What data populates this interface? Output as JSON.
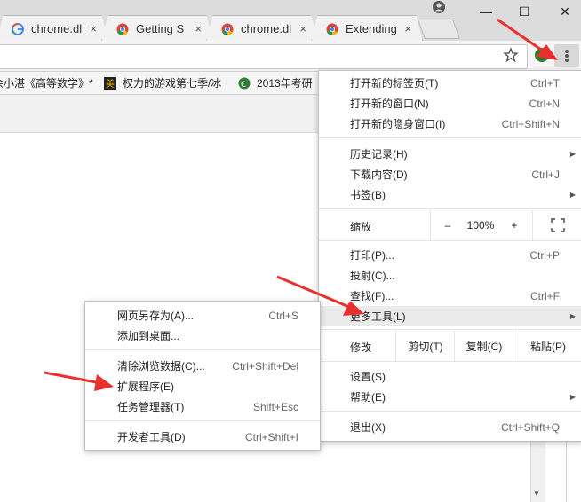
{
  "tabs": [
    {
      "title": "chrome.dl",
      "close": "×"
    },
    {
      "title": "Getting S",
      "close": "×"
    },
    {
      "title": "chrome.dl",
      "close": "×"
    },
    {
      "title": "Extending",
      "close": "×"
    }
  ],
  "window": {
    "minimize": "—",
    "maximize": "☐",
    "close": "✕"
  },
  "bookmarks": [
    {
      "label": "余小湛《高等数学》*"
    },
    {
      "label": "权力的游戏第七季/冰"
    },
    {
      "label": "2013年考研"
    }
  ],
  "menu": {
    "items": [
      {
        "label": "打开新的标签页(T)",
        "shortcut": "Ctrl+T"
      },
      {
        "label": "打开新的窗口(N)",
        "shortcut": "Ctrl+N"
      },
      {
        "label": "打开新的隐身窗口(I)",
        "shortcut": "Ctrl+Shift+N"
      },
      {
        "label": "历史记录(H)",
        "shortcut": ""
      },
      {
        "label": "下载内容(D)",
        "shortcut": "Ctrl+J"
      },
      {
        "label": "书签(B)",
        "shortcut": ""
      },
      {
        "label": "打印(P)...",
        "shortcut": "Ctrl+P"
      },
      {
        "label": "投射(C)...",
        "shortcut": ""
      },
      {
        "label": "查找(F)...",
        "shortcut": "Ctrl+F"
      },
      {
        "label": "更多工具(L)",
        "shortcut": ""
      },
      {
        "label": "设置(S)",
        "shortcut": ""
      },
      {
        "label": "帮助(E)",
        "shortcut": ""
      },
      {
        "label": "退出(X)",
        "shortcut": "Ctrl+Shift+Q"
      }
    ],
    "zoom": {
      "label": "缩放",
      "minus": "–",
      "value": "100%",
      "plus": "+"
    },
    "edit": {
      "label": "修改",
      "cut": "剪切(T)",
      "copy": "复制(C)",
      "paste": "粘贴(P)"
    },
    "submenu_arrow": "▶"
  },
  "submenu": {
    "items": [
      {
        "label": "网页另存为(A)...",
        "shortcut": "Ctrl+S"
      },
      {
        "label": "添加到桌面...",
        "shortcut": ""
      },
      {
        "label": "清除浏览数据(C)...",
        "shortcut": "Ctrl+Shift+Del"
      },
      {
        "label": "扩展程序(E)",
        "shortcut": ""
      },
      {
        "label": "任务管理器(T)",
        "shortcut": "Shift+Esc"
      },
      {
        "label": "开发者工具(D)",
        "shortcut": "Ctrl+Shift+I"
      }
    ]
  },
  "colors": {
    "annotation_arrow": "#e8312f",
    "highlight": "#ebebeb",
    "tabstrip": "#dcdcdc"
  },
  "icons": [
    "google-favicon",
    "chrome-favicon",
    "profile-icon",
    "star-icon",
    "extension-icon",
    "menu-dots-icon",
    "fullscreen-icon",
    "scroll-down-icon"
  ]
}
